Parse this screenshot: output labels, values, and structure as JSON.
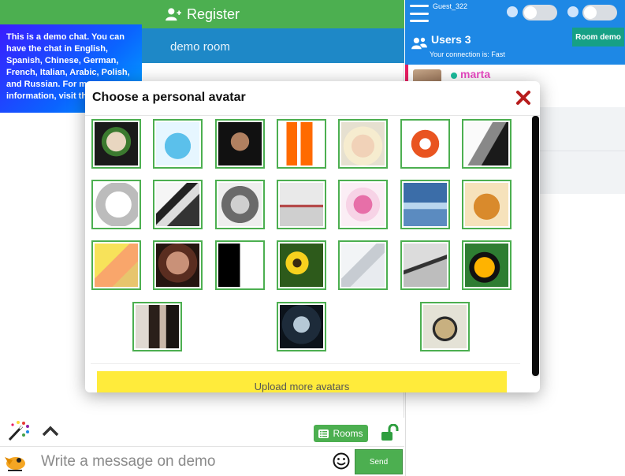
{
  "header": {
    "register_label": "Register"
  },
  "room": {
    "name": "demo room"
  },
  "demo_note": {
    "text": "This is a demo chat. You can have the chat in English, Spanish, Chinese, German, French, Italian, Arabic, Polish, and Russian. For more information, visit th"
  },
  "right_panel": {
    "guest_name": "Guest_322",
    "users_title": "Users 3",
    "connection_text": "Your connection is: Fast",
    "room_demo_label": "Room demo",
    "users": [
      {
        "name": "marta"
      }
    ]
  },
  "modal": {
    "title": "Choose a personal avatar",
    "upload_label": "Upload more avatars",
    "avatars": [
      "joker",
      "blue-cat",
      "man-sunglasses",
      "clownfish",
      "marilyn",
      "ubuntu-logo",
      "face-sketch",
      "mask-face",
      "eye-drawing",
      "walter-white",
      "lips-drip",
      "pink-lips",
      "blue-sky-drop",
      "puppy",
      "yellow-bird",
      "woman-red-eyes",
      "yin-yang",
      "sunflowers",
      "sleeping-face",
      "closed-eye",
      "cartoon-duck",
      "embracing-couple",
      "vampire-woman",
      "headphones-man"
    ]
  },
  "bottom": {
    "rooms_label": "Rooms",
    "message_placeholder": "Write a message on demo",
    "send_label": "Send"
  },
  "colors": {
    "green": "#4caf50",
    "blue": "#1e88e5",
    "room_bar": "#1e88c7",
    "teal": "#16a085",
    "yellow": "#ffeb3b"
  }
}
